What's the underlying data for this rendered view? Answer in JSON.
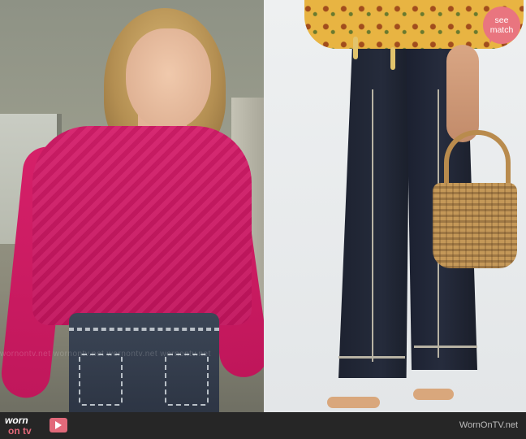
{
  "badge": {
    "line1": "see",
    "line2": "match",
    "color": "#e9757f"
  },
  "logo": {
    "word1": "worn",
    "word2": "on tv",
    "icon": "tv-play-icon",
    "accent": "#e2697a"
  },
  "credit": "WornOnTV.net",
  "watermark": "wornontv.net wornontv.net wornontv.net wornontv.net",
  "photos": [
    {
      "name": "left-still",
      "subject": "woman-in-pink-sweater-and-dark-jeans"
    },
    {
      "name": "right-product",
      "subject": "dark-wash-flare-jeans-with-woven-bag"
    }
  ]
}
